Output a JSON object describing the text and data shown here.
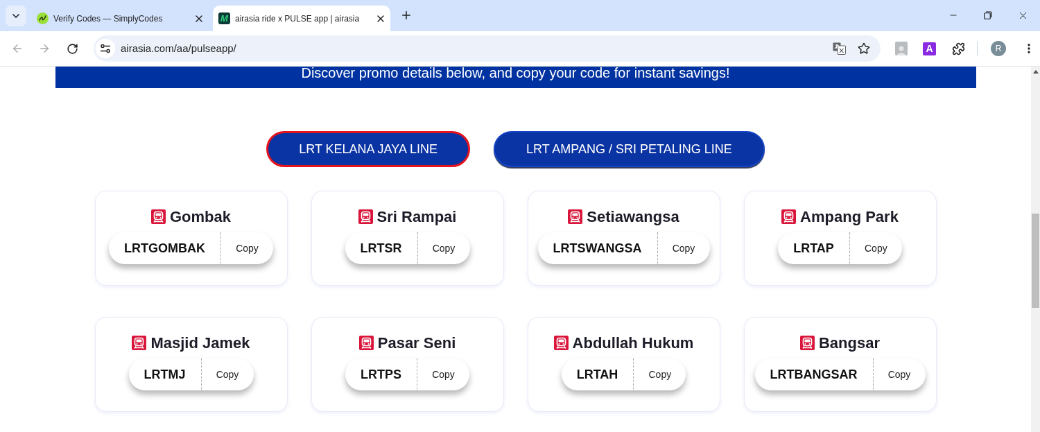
{
  "browser": {
    "tabs": [
      {
        "title": "Verify Codes — SimplyCodes",
        "selected": false
      },
      {
        "title": "airasia ride x PULSE app | airasia",
        "selected": true,
        "icon_text": "M"
      }
    ],
    "address": "airasia.com/aa/pulseapp/",
    "extension_label": "A",
    "profile_initial": "R"
  },
  "banner": {
    "text": "Discover promo details below, and copy your code for instant savings!"
  },
  "line_tabs": [
    {
      "label": "LRT KELANA JAYA LINE",
      "selected": true
    },
    {
      "label": "LRT AMPANG / SRI PETALING LINE",
      "selected": false
    }
  ],
  "stations": [
    {
      "name": "Gombak",
      "code": "LRTGOMBAK",
      "button": "Copy"
    },
    {
      "name": "Sri Rampai",
      "code": "LRTSR",
      "button": "Copy"
    },
    {
      "name": "Setiawangsa",
      "code": "LRTSWANGSA",
      "button": "Copy"
    },
    {
      "name": "Ampang Park",
      "code": "LRTAP",
      "button": "Copy"
    },
    {
      "name": "Masjid Jamek",
      "code": "LRTMJ",
      "button": "Copy"
    },
    {
      "name": "Pasar Seni",
      "code": "LRTPS",
      "button": "Copy"
    },
    {
      "name": "Abdullah Hukum",
      "code": "LRTAH",
      "button": "Copy"
    },
    {
      "name": "Bangsar",
      "code": "LRTBANGSAR",
      "button": "Copy"
    }
  ]
}
